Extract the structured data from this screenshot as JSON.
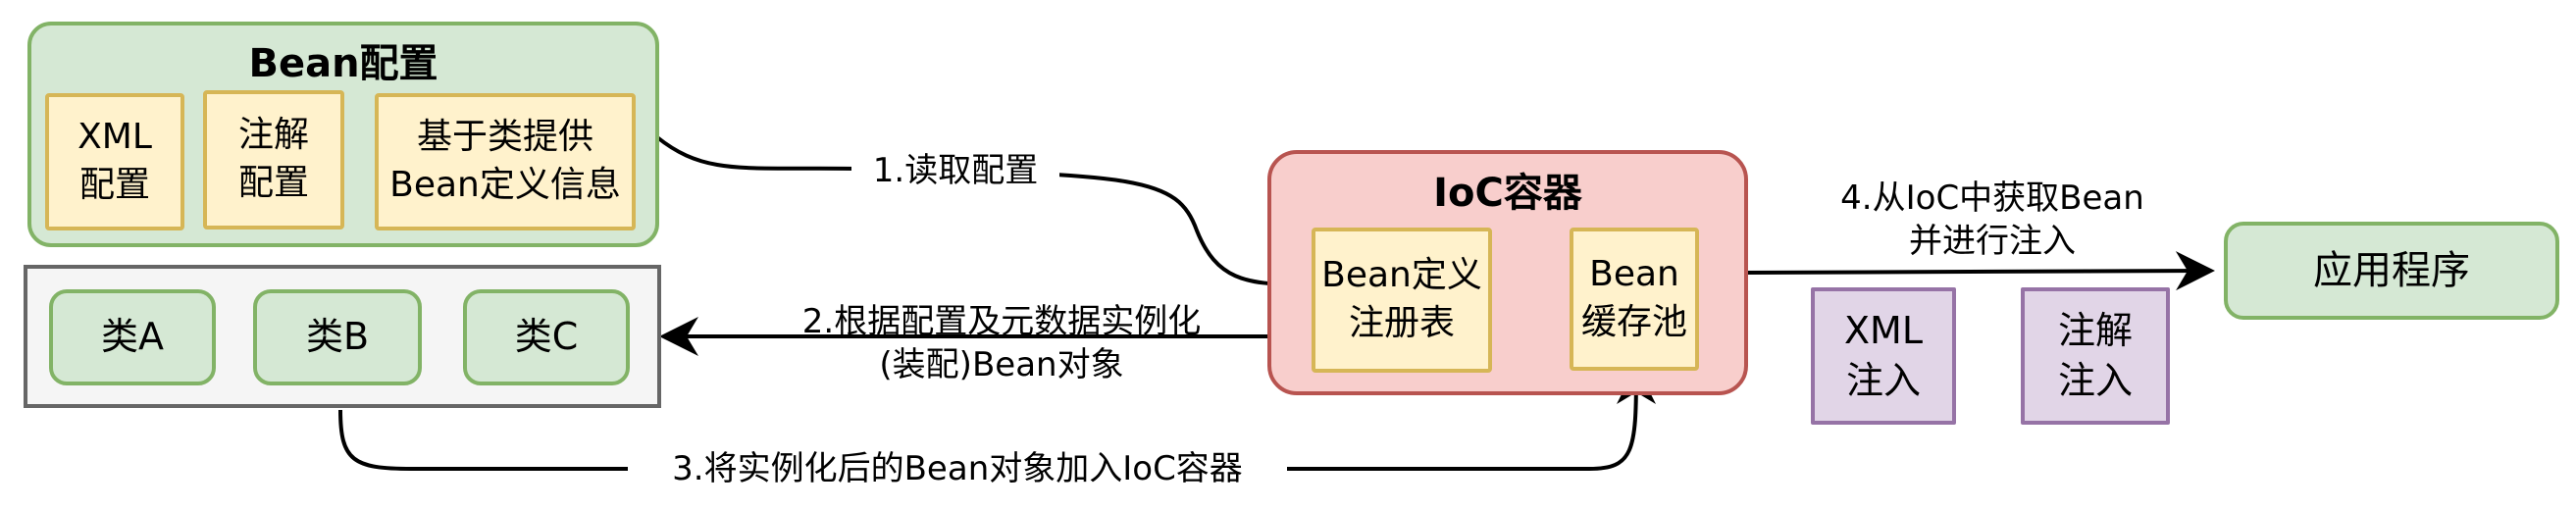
{
  "bean_config": {
    "title": "Bean配置",
    "xml": "XML\n配置",
    "annotation": "注解\n配置",
    "class_based": "基于类提供\nBean定义信息"
  },
  "classes": [
    "类A",
    "类B",
    "类C"
  ],
  "ioc": {
    "title": "IoC容器",
    "registry": "Bean定义\n注册表",
    "cache": "Bean\n缓存池"
  },
  "app": "应用程序",
  "injection": {
    "xml": "XML\n注入",
    "annotation": "注解\n注入"
  },
  "edges": {
    "step1": "1.读取配置",
    "step2": "2.根据配置及元数据实例化\n(装配)Bean对象",
    "step3": "3.将实例化后的Bean对象加入IoC容器",
    "step4": "4.从IoC中获取Bean\n并进行注入"
  },
  "colors": {
    "green_fill": "#d5e8d4",
    "green_stroke": "#82b366",
    "yellow_fill": "#fff2cc",
    "yellow_stroke": "#d6b656",
    "red_fill": "#f8cecc",
    "red_stroke": "#b85450",
    "purple_fill": "#e1d5e7",
    "purple_stroke": "#9673a6",
    "grey_fill": "#f5f5f5",
    "grey_stroke": "#666666"
  }
}
